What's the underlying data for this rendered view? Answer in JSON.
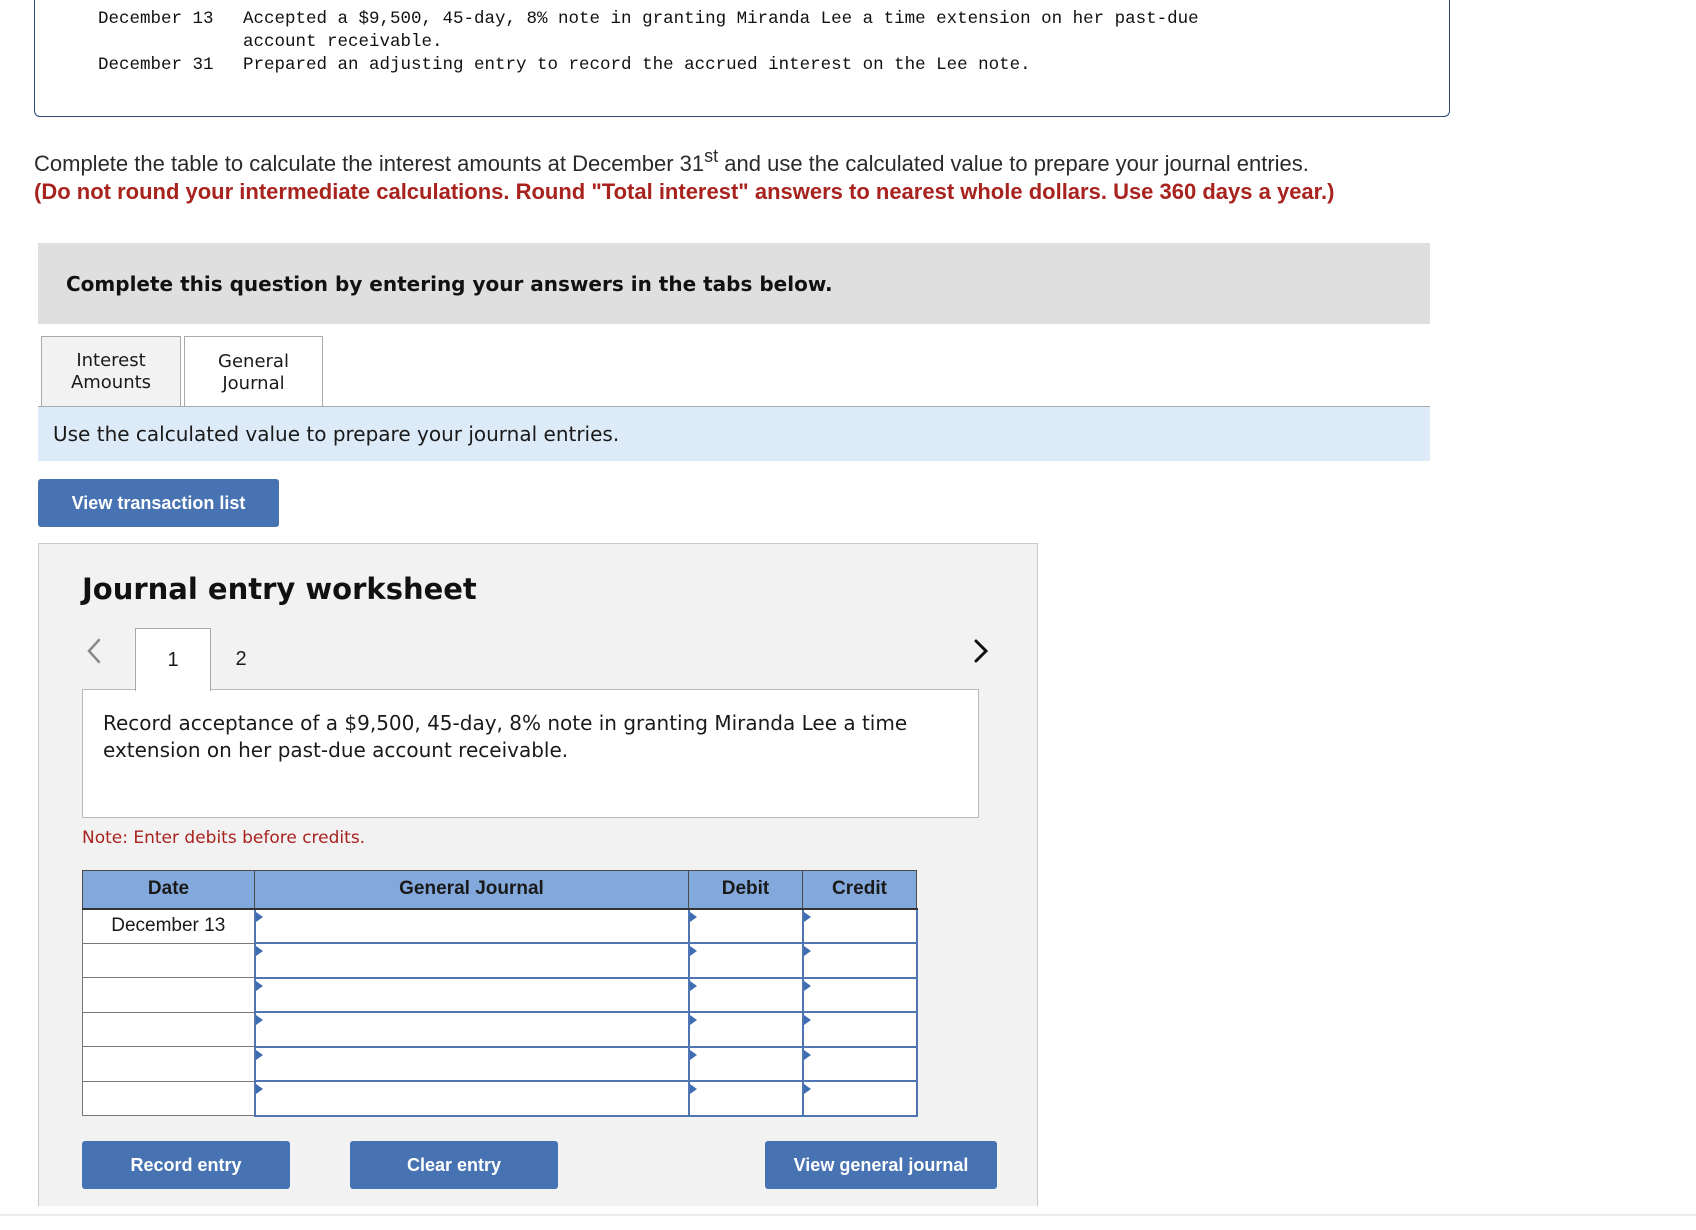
{
  "transactions": [
    {
      "date": "December 13",
      "text": "Accepted a $9,500, 45-day, 8% note in granting Miranda Lee a time extension on her past-due",
      "continuation": "account receivable."
    },
    {
      "date": "December 31",
      "text": "Prepared an adjusting entry to record the accrued interest on the Lee note."
    }
  ],
  "instructions": {
    "main_before": "Complete the table to calculate the interest amounts at December 31",
    "main_sup": "st",
    "main_after": " and use the calculated value to prepare your journal entries.",
    "red_note": "(Do not round your intermediate calculations. Round \"Total interest\" answers to nearest whole dollars. Use 360 days a year.)"
  },
  "banner": {
    "text": "Complete this question by entering your answers in the tabs below."
  },
  "tabs": [
    {
      "label_line1": "Interest",
      "label_line2": "Amounts",
      "active": false
    },
    {
      "label_line1": "General",
      "label_line2": "Journal",
      "active": true
    }
  ],
  "info_bar": {
    "text": "Use the calculated value to prepare your journal entries."
  },
  "buttons": {
    "view_transaction_list": "View transaction list",
    "record_entry": "Record entry",
    "clear_entry": "Clear entry",
    "view_general_journal": "View general journal"
  },
  "worksheet": {
    "title": "Journal entry worksheet",
    "entry_tabs": [
      "1",
      "2"
    ],
    "active_entry": "1",
    "description": "Record acceptance of a $9,500, 45-day, 8% note in granting Miranda Lee a time extension on her past-due account receivable.",
    "note": "Note: Enter debits before credits.",
    "table": {
      "headers": [
        "Date",
        "General Journal",
        "Debit",
        "Credit"
      ],
      "rows": [
        {
          "date": "December 13",
          "account": "",
          "debit": "",
          "credit": ""
        },
        {
          "date": "",
          "account": "",
          "debit": "",
          "credit": ""
        },
        {
          "date": "",
          "account": "",
          "debit": "",
          "credit": ""
        },
        {
          "date": "",
          "account": "",
          "debit": "",
          "credit": ""
        },
        {
          "date": "",
          "account": "",
          "debit": "",
          "credit": ""
        },
        {
          "date": "",
          "account": "",
          "debit": "",
          "credit": ""
        }
      ]
    }
  },
  "colors": {
    "button_blue": "#4873b2",
    "header_blue": "#83a9dc",
    "info_bar_blue": "#ddeaf7",
    "red_text": "#a8221e",
    "banner_gray": "#dfdfdf"
  }
}
